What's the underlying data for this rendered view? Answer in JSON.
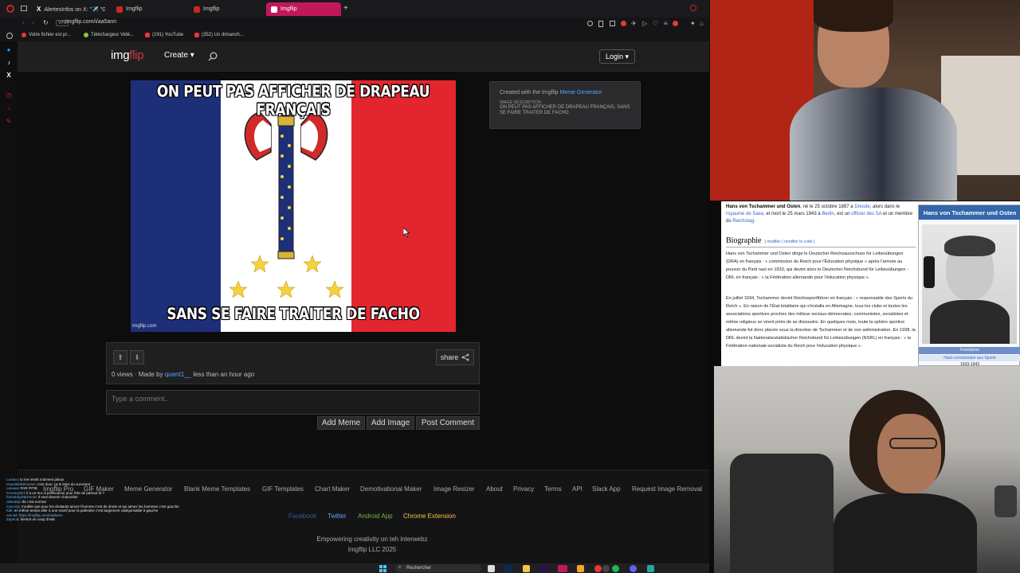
{
  "browser": {
    "tabs": [
      {
        "label": "AlertesInfos on X: \"✈️ \"G..."
      },
      {
        "label": "Imgflip"
      },
      {
        "label": "Imgflip"
      },
      {
        "label": "Imgflip"
      }
    ],
    "vpn_label": "VPN",
    "url": "imgflip.com/i/aa5ann",
    "bookmarks": [
      "Votre fichier est pr...",
      "Téléchargeur Vidé...",
      "(191) YouTube",
      "(352) Un dimanch..."
    ]
  },
  "site": {
    "logo_img": "img",
    "logo_flip": "flip",
    "create_label": "Create ▾",
    "login_label": "Login ▾"
  },
  "meme": {
    "top_text": "ON PEUT PAS AFFICHER DE DRAPEAU FRANÇAIS",
    "bottom_text": "SANS SE FAIRE TRAITER DE FACHO",
    "watermark": "imgflip.com"
  },
  "info": {
    "created_prefix": "Created with the Imgflip",
    "created_link": "Meme Generator",
    "desc_label": "IMAGE DESCRIPTION:",
    "desc_text": "ON PEUT PAS AFFICHER DE DRAPEAU FRANÇAIS, SANS SE FAIRE TRAITER DE FACHO"
  },
  "post": {
    "share_label": "share",
    "views": "0 views · Made by",
    "author": "quent1__",
    "time": "less than an hour ago",
    "comment_placeholder": "Type a comment..",
    "add_meme": "Add Meme",
    "add_image": "Add Image",
    "post_comment": "Post Comment"
  },
  "footer": {
    "links": [
      "Imgflip Pro",
      "GIF Maker",
      "Meme Generator",
      "Blank Meme Templates",
      "GIF Templates",
      "Chart Maker",
      "Demotivational Maker",
      "Image Resizer",
      "About",
      "Privacy",
      "Terms",
      "API",
      "Slack App",
      "Request Image Removal"
    ],
    "social": [
      "Facebook",
      "Twitter",
      "Android App",
      "Chrome Extension"
    ],
    "tagline": "Empowering creativity on teh interwebz",
    "copyright": "Imgflip LLC 2025"
  },
  "chat": [
    {
      "user": "Lunaxx",
      "msg": "tu me rends vraiment jaloux"
    },
    {
      "user": "GuardenRemorse",
      "msg": "c'est donc ça le biais du survivant"
    },
    {
      "user": "Leeaaa",
      "msg": "PAR PITIE"
    },
    {
      "user": "CreamyGirl",
      "msg": "il a un truc à promouvoir pour être de partout là ?"
    },
    {
      "user": "homeboyDaHomie",
      "msg": "Il veut devenir chancelier"
    },
    {
      "user": "oilandrip",
      "msg": "tkt c'est normal"
    },
    {
      "user": "zoocorp",
      "msg": "n'oublie que pour les droitards aimez l'homme c'est de droite et qui aimez les hommes c'est gauche"
    },
    {
      "user": "Kiki",
      "msg": "en même temps aller à une manif pour la palestine c'est largement catégorisable à gauche"
    },
    {
      "user": "omnist",
      "msg": "https://imgflip.com/i/aa5ann"
    },
    {
      "user": "Zaphod",
      "msg": "bientot un coup d'etat"
    }
  ],
  "taskbar": {
    "search_label": "Rechercher"
  },
  "wiki": {
    "lead_name": "Hans von Tschammer und Osten",
    "lead_rest_1": ", né le 25 octobre 1887 à",
    "lead_link_1": "Dresde",
    "lead_rest_2": ", alors dans le",
    "lead_link_2": "royaume de Saxe",
    "lead_rest_3": ", et mort le 25 mars 1943 à",
    "lead_link_3": "Berlin",
    "lead_rest_4": ", est un",
    "lead_link_4": "officier des SA",
    "lead_rest_5": "et un membre du",
    "lead_link_5": "Reichstag",
    "h2": "Biographie",
    "edit": "[ modifier | modifier le code ]",
    "p1": "Hans von Tschammer und Osten dirige le Deutscher Reichsausschuss für Leibesübungen (DRA) en français : « commission du Reich pour l'Éducation physique » après l'arrivée au pouvoir du Parti nazi en 1933, qui devint alors le Deutscher Reichsbund für Leibesübungen - DRL en français : « la Fédération allemande pour l'éducation physique ».",
    "p2": "En juillet 1934, Tschammer devint Reichssportführer en français : « responsable des Sports du Reich ». En raison de l'État totalitaire qui s'installa en Allemagne, tous les clubs et toutes les associations sportives proches des milieux sociaux-démocrates, communistes, socialistes et même religieux se virent priés de se dissoudre. En quelques mois, toute la sphère sportive allemande fut donc placée sous la direction de Tschammer et de son administration. En 1938, la DRL devint la Nationalsozialistischer Reichsbund für Leibesübungen (NSRL) en français : « la Fédération nationale-socialiste du Reich pour l'éducation physique ».",
    "infobox_title": "Hans von Tschammer und Osten",
    "infobox_fn": "Fonctions",
    "infobox_role": "Haut-commissaire aux Sports",
    "infobox_years": "1933-1943"
  },
  "colors": {
    "imgflip_red": "#c83b3b",
    "tab_active": "#c2185b",
    "link_blue": "#58a6ff",
    "flag_blue": "#1e2f7a",
    "flag_red": "#e3262e"
  }
}
